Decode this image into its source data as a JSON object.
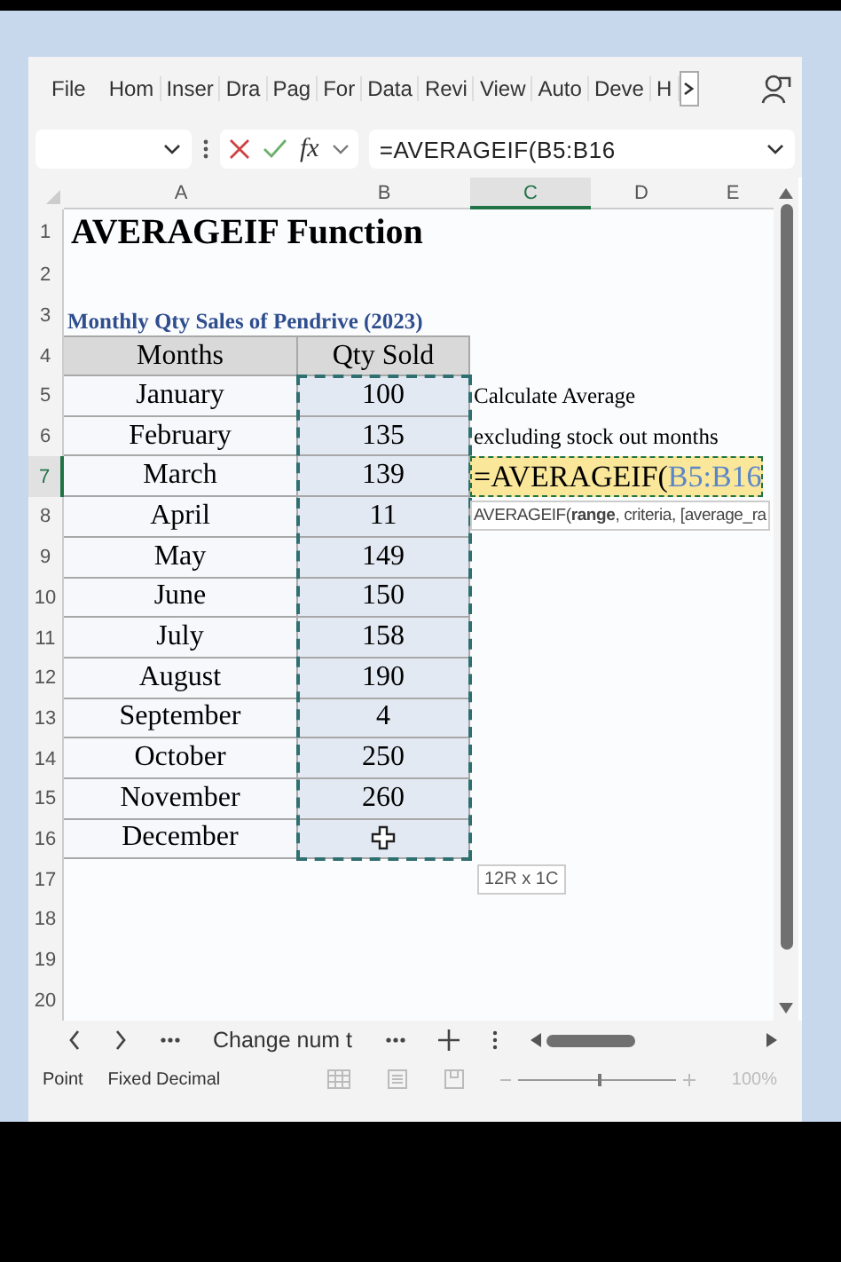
{
  "ribbon": {
    "tabs": [
      "File",
      "Hom",
      "Inser",
      "Dra",
      "Pag",
      "For",
      "Data",
      "Revi",
      "View",
      "Auto",
      "Deve",
      "H"
    ]
  },
  "formula_bar": {
    "function_label": "fx",
    "formula": "=AVERAGEIF(B5:B16"
  },
  "sheet": {
    "columns": [
      {
        "label": "A",
        "selected": false
      },
      {
        "label": "B",
        "selected": false
      },
      {
        "label": "C",
        "selected": true
      },
      {
        "label": "D",
        "selected": false
      },
      {
        "label": "E",
        "selected": false
      }
    ],
    "rows": [
      {
        "label": "1",
        "selected": false
      },
      {
        "label": "2",
        "selected": false
      },
      {
        "label": "3",
        "selected": false
      },
      {
        "label": "4",
        "selected": false
      },
      {
        "label": "5",
        "selected": false
      },
      {
        "label": "6",
        "selected": false
      },
      {
        "label": "7",
        "selected": true
      },
      {
        "label": "8",
        "selected": false
      },
      {
        "label": "9",
        "selected": false
      },
      {
        "label": "10",
        "selected": false
      },
      {
        "label": "11",
        "selected": false
      },
      {
        "label": "12",
        "selected": false
      },
      {
        "label": "13",
        "selected": false
      },
      {
        "label": "14",
        "selected": false
      },
      {
        "label": "15",
        "selected": false
      },
      {
        "label": "16",
        "selected": false
      },
      {
        "label": "17",
        "selected": false
      },
      {
        "label": "18",
        "selected": false
      },
      {
        "label": "19",
        "selected": false
      },
      {
        "label": "20",
        "selected": false
      }
    ],
    "title": "AVERAGEIF Function",
    "subtitle": "Monthly Qty Sales of Pendrive (2023)",
    "table": {
      "columns": [
        "Months",
        "Qty Sold"
      ],
      "rows": [
        [
          "January",
          "100"
        ],
        [
          "February",
          "135"
        ],
        [
          "March",
          "139"
        ],
        [
          "April",
          "11"
        ],
        [
          "May",
          "149"
        ],
        [
          "June",
          "150"
        ],
        [
          "July",
          "158"
        ],
        [
          "August",
          "190"
        ],
        [
          "September",
          "4"
        ],
        [
          "October",
          "250"
        ],
        [
          "November",
          "260"
        ],
        [
          "December",
          ""
        ]
      ]
    },
    "notes": [
      "Calculate Average",
      "excluding stock out months"
    ],
    "editing_cell": {
      "prefix": "=AVERAGEIF(",
      "range": "B5:B16"
    },
    "tooltip": "AVERAGEIF(**range**, criteria, [average_ra",
    "selection_size": "12R x 1C"
  },
  "sheet_tabs": {
    "active": "Change num t"
  },
  "status_bar": {
    "mode": "Point",
    "fixed": "Fixed Decimal",
    "zoom": {
      "level": 0.5,
      "reading": "100%"
    }
  }
}
